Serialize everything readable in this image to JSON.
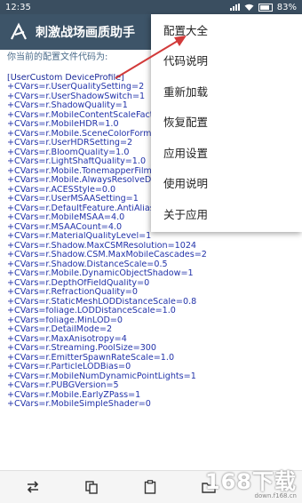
{
  "statusbar": {
    "time": "12:35",
    "battery": "83%"
  },
  "appbar": {
    "title": "刺激战场画质助手"
  },
  "content": {
    "caption": "你当前的配置文件代码为:",
    "lines": [
      "[UserCustom DeviceProfile]",
      "+CVars=r.UserQualitySetting=2",
      "+CVars=r.UserShadowSwitch=1",
      "+CVars=r.ShadowQuality=1",
      "+CVars=r.MobileContentScaleFactor=",
      "+CVars=r.MobileHDR=1.0",
      "+CVars=r.Mobile.SceneColorFormat=",
      "+CVars=r.UserHDRSetting=2",
      "+CVars=r.BloomQuality=1.0",
      "+CVars=r.LightShaftQuality=1.0",
      "+CVars=r.Mobile.TonemapperFilm=",
      "+CVars=r.Mobile.AlwaysResolveDe",
      "+CVars=r.ACESStyle=0.0",
      "+CVars=r.UserMSAASetting=1",
      "+CVars=r.DefaultFeature.AntiAliasi",
      "+CVars=r.MobileMSAA=4.0",
      "+CVars=r.MSAACount=4.0",
      "+CVars=r.MaterialQualityLevel=1",
      "+CVars=r.Shadow.MaxCSMResolution=1024",
      "+CVars=r.Shadow.CSM.MaxMobileCascades=2",
      "+CVars=r.Shadow.DistanceScale=0.5",
      "+CVars=r.Mobile.DynamicObjectShadow=1",
      "+CVars=r.DepthOfFieldQuality=0",
      "+CVars=r.RefractionQuality=0",
      "+CVars=r.StaticMeshLODDistanceScale=0.8",
      "+CVars=foliage.LODDistanceScale=1.0",
      "+CVars=foliage.MinLOD=0",
      "+CVars=r.DetailMode=2",
      "+CVars=r.MaxAnisotropy=4",
      "+CVars=r.Streaming.PoolSize=300",
      "+CVars=r.EmitterSpawnRateScale=1.0",
      "+CVars=r.ParticleLODBias=0",
      "+CVars=r.MobileNumDynamicPointLights=1",
      "+CVars=r.PUBGVersion=5",
      "+CVars=r.Mobile.EarlyZPass=1",
      "+CVars=r.MobileSimpleShader=0"
    ]
  },
  "menu": {
    "items": [
      "配置大全",
      "代码说明",
      "重新加载",
      "恢复配置",
      "应用设置",
      "使用说明",
      "关于应用"
    ]
  },
  "watermark": {
    "brand": "168下载",
    "url": "down.f168.cn"
  },
  "colors": {
    "appbar": "#3d5468",
    "statusbar": "#3a4e60",
    "code_text": "#2233aa",
    "arrow": "#d23a3a"
  }
}
